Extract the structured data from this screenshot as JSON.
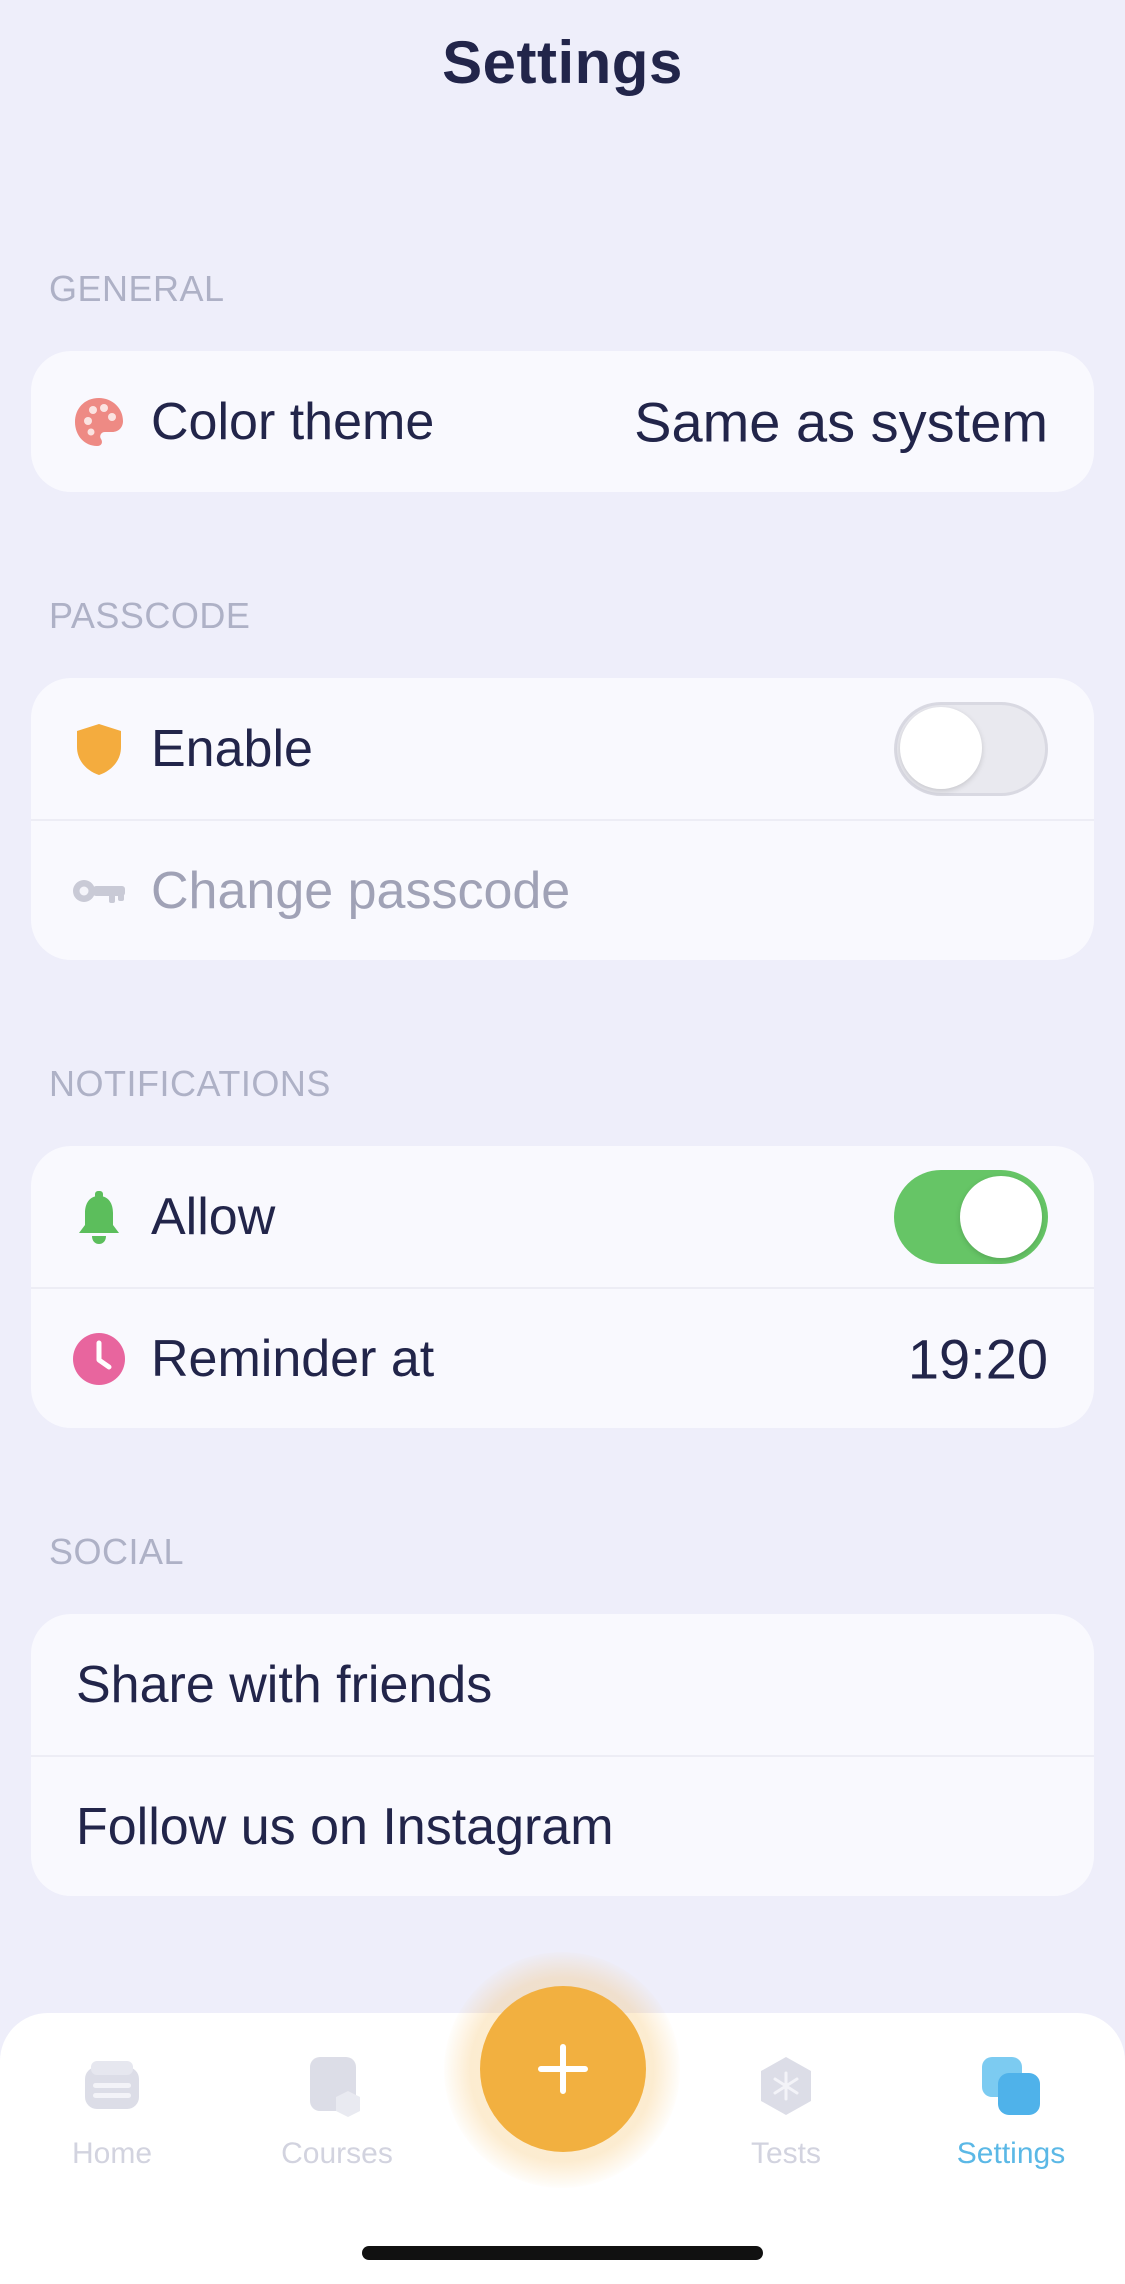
{
  "header": {
    "title": "Settings"
  },
  "sections": {
    "general": {
      "header": "GENERAL",
      "color_theme": {
        "label": "Color theme",
        "value": "Same as system",
        "icon": "palette-icon"
      }
    },
    "passcode": {
      "header": "PASSCODE",
      "enable": {
        "label": "Enable",
        "icon": "shield-icon",
        "toggle_on": false
      },
      "change": {
        "label": "Change passcode",
        "icon": "key-icon",
        "disabled": true
      }
    },
    "notifications": {
      "header": "NOTIFICATIONS",
      "allow": {
        "label": "Allow",
        "icon": "bell-icon",
        "toggle_on": true
      },
      "reminder": {
        "label": "Reminder at",
        "value": "19:20",
        "icon": "clock-icon"
      }
    },
    "social": {
      "header": "SOCIAL",
      "share": {
        "label": "Share with friends"
      },
      "instagram": {
        "label": "Follow us on Instagram"
      }
    }
  },
  "tabbar": {
    "tabs": [
      {
        "label": "Home",
        "icon": "home-icon",
        "active": false
      },
      {
        "label": "Courses",
        "icon": "courses-icon",
        "active": false
      },
      {
        "label": "Tests",
        "icon": "tests-icon",
        "active": false
      },
      {
        "label": "Settings",
        "icon": "settings-icon",
        "active": true
      }
    ],
    "add_button_icon": "plus-icon"
  },
  "colors": {
    "background": "#EEEEFA",
    "card": "#F9F9FE",
    "text": "#22254A",
    "section_header": "#AEB1C6",
    "toggle_on": "#66C566",
    "fab": "#F2B040",
    "active_tab": "#5BB8E6"
  }
}
